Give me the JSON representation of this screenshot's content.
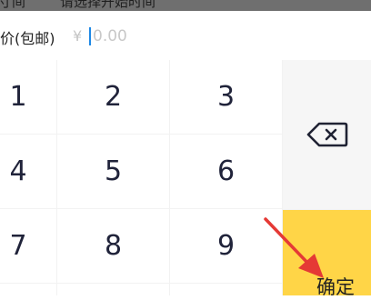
{
  "top_strip": {
    "left_text": "寸间",
    "right_text": "请选择开始时间"
  },
  "price": {
    "label": "价(包邮)",
    "currency": "¥",
    "placeholder": "0.00"
  },
  "keypad": {
    "keys": [
      "1",
      "2",
      "3",
      "4",
      "5",
      "6",
      "7",
      "8",
      "9"
    ],
    "confirm_label": "确定"
  },
  "colors": {
    "confirm": "#ffd547",
    "arrow": "#e53935",
    "cursor": "#1e88e5"
  },
  "icons": {
    "backspace": "backspace-icon",
    "annotation": "red-arrow-icon"
  }
}
